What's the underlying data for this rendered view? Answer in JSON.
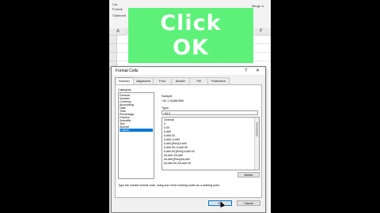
{
  "banner": {
    "line1": "Click",
    "line2": "OK"
  },
  "excel": {
    "ribbon": {
      "item1": "Cut",
      "item2": "Format",
      "item3": "Clipboard",
      "item4": "Merge &"
    },
    "columns": [
      "A",
      "F"
    ]
  },
  "dialog": {
    "title": "Format Cells",
    "help": "?",
    "close": "✕",
    "tabs": [
      "Number",
      "Alignment",
      "Font",
      "Border",
      "Fill",
      "Protection"
    ],
    "category_label": "Category:",
    "categories": [
      "General",
      "Number",
      "Currency",
      "Accounting",
      "Date",
      "Time",
      "Percentage",
      "Fraction",
      "Scientific",
      "Text",
      "Special",
      "Custom"
    ],
    "selected_category": "Custom",
    "sample_label": "Sample",
    "sample_value": "+44 1 234567890",
    "type_label": "Type:",
    "type_value": "+44 0",
    "formats": [
      "General",
      "0",
      "0.00",
      "#,##0",
      "#,##0.00",
      "#,##0;-#,##0",
      "#,##0;[Red]-#,##0",
      "#,##0.00;-#,##0.00",
      "#,##0.00;[Red]-#,##0.00",
      "£#,##0;-£#,##0",
      "£#,##0;[Red]-£#,##0",
      "£#,##0.00;-£#,##0.00"
    ],
    "delete_button": "Delete",
    "hint": "Type the number format code, using one of the existing codes as a starting point.",
    "ok_button": "OK",
    "cancel_button": "Cancel"
  }
}
